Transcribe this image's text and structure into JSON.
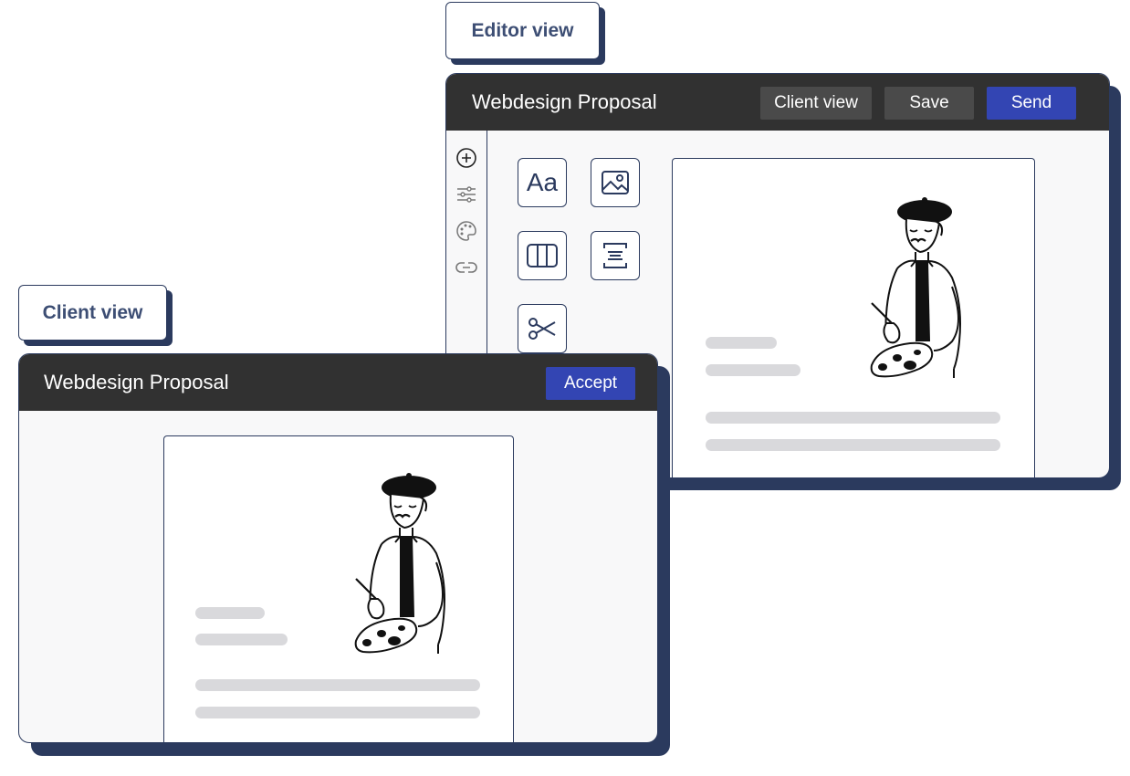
{
  "editor_tag": {
    "label": "Editor view"
  },
  "client_tag": {
    "label": "Client view"
  },
  "editor_window": {
    "title": "Webdesign Proposal",
    "buttons": {
      "client_view": "Client view",
      "save": "Save",
      "send": "Send"
    },
    "sidebar_icons": [
      "add-circle-icon",
      "sliders-icon",
      "palette-icon",
      "link-icon"
    ],
    "tools": [
      {
        "name": "text-tool",
        "label": "Aa"
      },
      {
        "name": "image-tool",
        "icon": "image-icon"
      },
      {
        "name": "columns-tool",
        "icon": "columns-icon"
      },
      {
        "name": "spacer-tool",
        "icon": "spacer-icon"
      },
      {
        "name": "cut-tool",
        "icon": "scissors-icon"
      }
    ]
  },
  "client_window": {
    "title": "Webdesign Proposal",
    "buttons": {
      "accept": "Accept"
    }
  },
  "colors": {
    "navy": "#2b3a5e",
    "titlebar": "#313131",
    "blue_button": "#3345b3",
    "grey_button": "#4a4a4a",
    "placeholder": "#d9d9dc"
  }
}
